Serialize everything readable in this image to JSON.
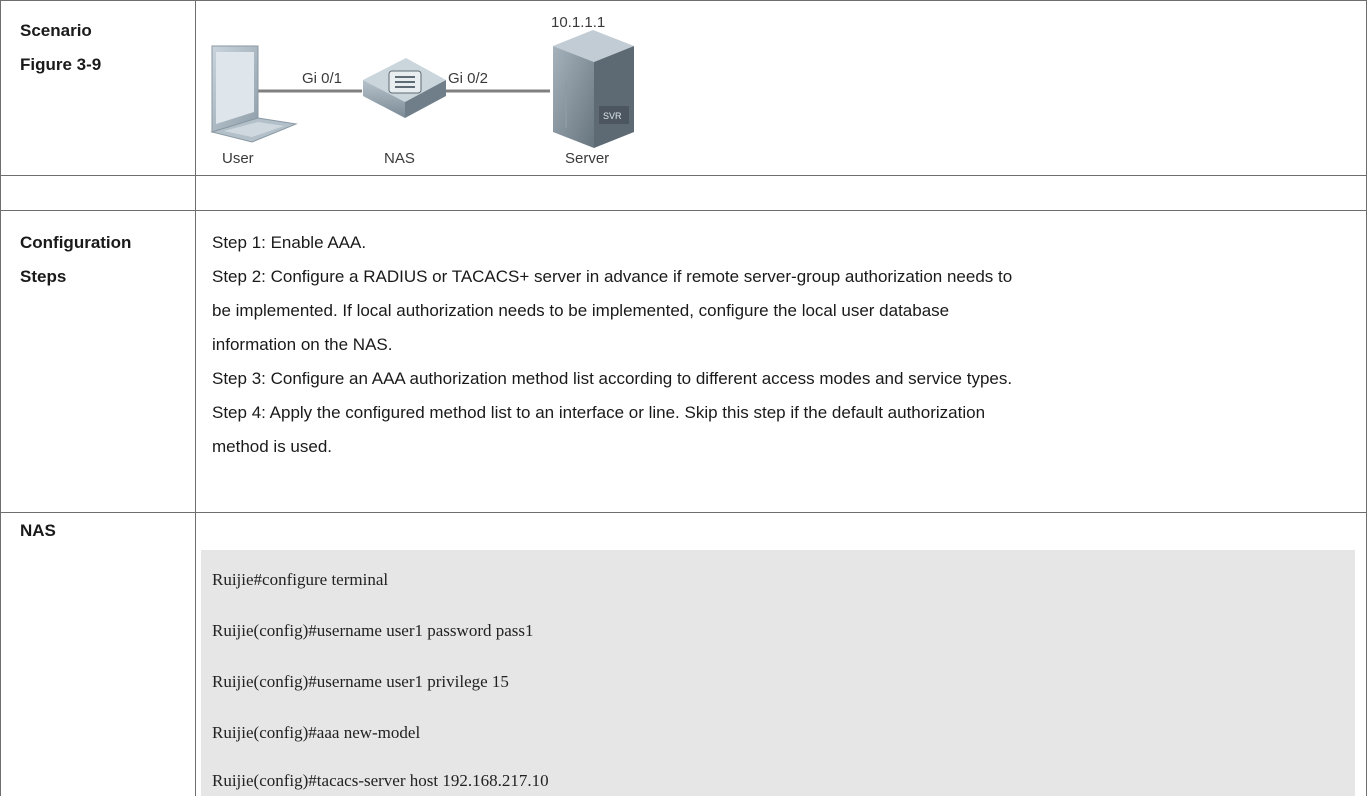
{
  "rows": {
    "scenario": {
      "label_line1": "Scenario",
      "label_line2": "Figure 3-9",
      "diagram": {
        "server_ip": "10.1.1.1",
        "link1_label": "Gi 0/1",
        "link2_label": "Gi 0/2",
        "user_label": "User",
        "nas_label": "NAS",
        "server_label": "Server"
      }
    },
    "configuration_steps": {
      "label_line1": "Configuration",
      "label_line2": "Steps",
      "lines": [
        "Step 1: Enable AAA.",
        "Step 2: Configure a RADIUS or TACACS+ server in advance if remote server-group authorization needs to",
        "be implemented. If local authorization needs to be implemented, configure the local user database",
        "information on the NAS.",
        "Step 3: Configure an AAA authorization method list according to different access modes and service types.",
        "Step 4: Apply the configured method list to an interface or line. Skip this step if the default authorization",
        "method is used."
      ]
    },
    "nas": {
      "label": "NAS",
      "code_lines": [
        "Ruijie#configure terminal",
        "Ruijie(config)#username user1 password pass1",
        "Ruijie(config)#username user1 privilege 15",
        "Ruijie(config)#aaa new-model",
        "Ruijie(config)#tacacs-server host 192.168.217.10"
      ]
    }
  }
}
